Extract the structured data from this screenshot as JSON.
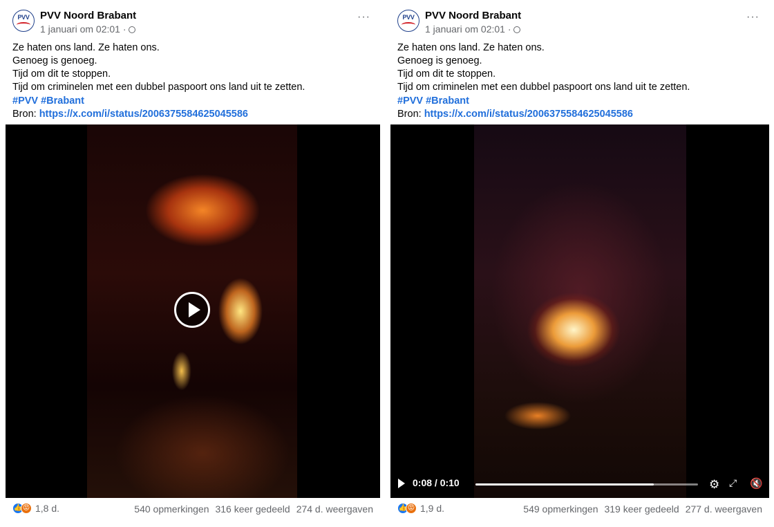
{
  "posts": [
    {
      "page_name": "PVV Noord Brabant",
      "avatar_text": "PVV",
      "timestamp": "1 januari om 02:01 ·",
      "more_label": "···",
      "text_lines": [
        "Ze haten ons land. Ze haten ons.",
        "Genoeg is genoeg.",
        "Tijd om dit te stoppen.",
        "Tijd om criminelen met een dubbel paspoort ons land uit te zetten."
      ],
      "hashtags": "#PVV #Brabant",
      "source_label": "Bron: ",
      "source_link": "https://x.com/i/status/2006375584625045586",
      "video_state": "paused",
      "reaction_count": "1,8 d.",
      "comments": "540 opmerkingen",
      "shares": "316 keer gedeeld",
      "views": "274 d. weergaven"
    },
    {
      "page_name": "PVV Noord Brabant",
      "avatar_text": "PVV",
      "timestamp": "1 januari om 02:01 ·",
      "more_label": "···",
      "text_lines": [
        "Ze haten ons land. Ze haten ons.",
        "Genoeg is genoeg.",
        "Tijd om dit te stoppen.",
        "Tijd om criminelen met een dubbel paspoort ons land uit te zetten."
      ],
      "hashtags": "#PVV #Brabant",
      "source_label": "Bron: ",
      "source_link": "https://x.com/i/status/2006375584625045586",
      "video_state": "playing",
      "video_time": "0:08 / 0:10",
      "video_progress": 0.8,
      "reaction_count": "1,9 d.",
      "comments": "549 opmerkingen",
      "shares": "319 keer gedeeld",
      "views": "277 d. weergaven"
    }
  ],
  "icons": {
    "globe": "globe-icon",
    "play": "play-icon",
    "settings": "gear-icon",
    "fullscreen": "expand-icon",
    "mute": "mute-icon",
    "like": "like-icon",
    "angry": "angry-icon"
  },
  "colors": {
    "link": "#216fdb",
    "like": "#1877f2",
    "angry": "#e9710f",
    "meta_text": "#65676b"
  }
}
